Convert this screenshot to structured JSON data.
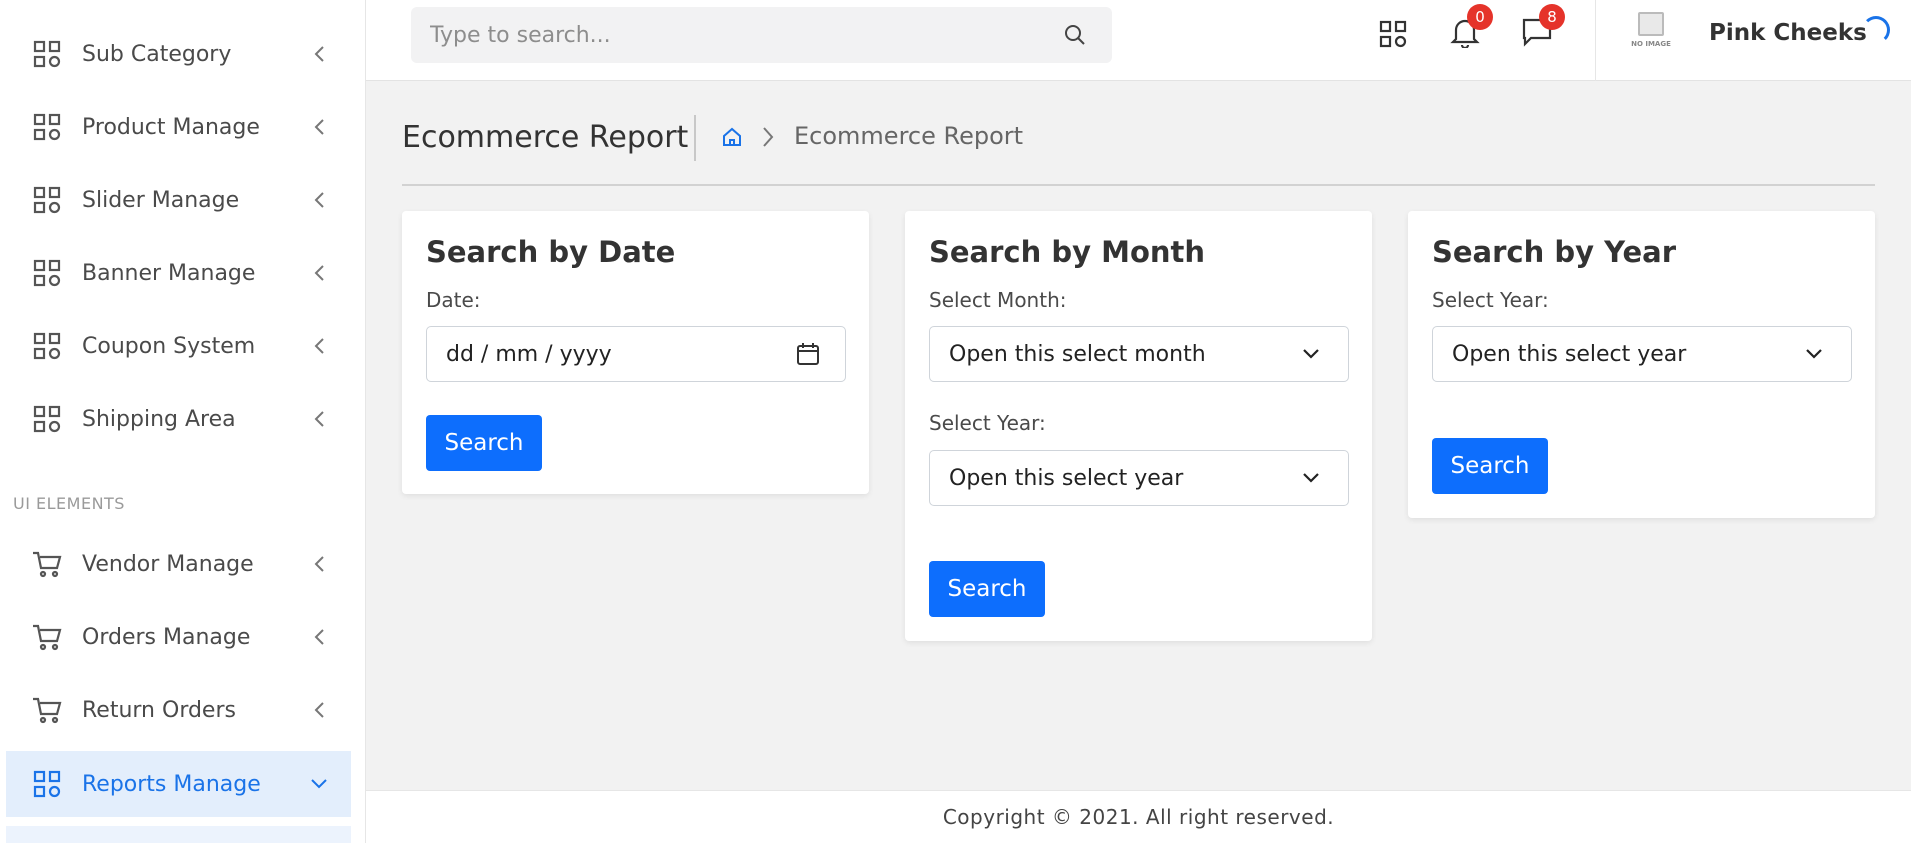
{
  "sidebar": {
    "items": [
      {
        "label": "Sub Category",
        "icon": "grid-icon"
      },
      {
        "label": "Product Manage",
        "icon": "grid-icon"
      },
      {
        "label": "Slider Manage",
        "icon": "grid-icon"
      },
      {
        "label": "Banner Manage",
        "icon": "grid-icon"
      },
      {
        "label": "Coupon System",
        "icon": "grid-icon"
      },
      {
        "label": "Shipping Area",
        "icon": "grid-icon"
      }
    ],
    "section_label": "UI ELEMENTS",
    "ui_items": [
      {
        "label": "Vendor Manage",
        "icon": "cart-icon"
      },
      {
        "label": "Orders Manage",
        "icon": "cart-icon"
      },
      {
        "label": "Return Orders",
        "icon": "cart-icon"
      },
      {
        "label": "Reports Manage",
        "icon": "grid-icon",
        "active": true
      }
    ]
  },
  "topbar": {
    "search_placeholder": "Type to search...",
    "notifications_count": "0",
    "messages_count": "8",
    "avatar_caption": "NO IMAGE",
    "user_name": "Pink Cheeks"
  },
  "page": {
    "title": "Ecommerce Report",
    "breadcrumb_current": "Ecommerce Report"
  },
  "cards": {
    "date": {
      "title": "Search by Date",
      "label": "Date:",
      "value": "dd / mm / yyyy",
      "button": "Search"
    },
    "month": {
      "title": "Search by Month",
      "month_label": "Select Month:",
      "month_value": "Open this select month",
      "year_label": "Select Year:",
      "year_value": "Open this select year",
      "button": "Search"
    },
    "year": {
      "title": "Search by Year",
      "label": "Select Year:",
      "value": "Open this select year",
      "button": "Search"
    }
  },
  "footer": {
    "text": "Copyright © 2021. All right reserved."
  },
  "colors": {
    "accent": "#1a73e8",
    "button": "#0d6efd",
    "badge": "#e5332a",
    "active_bg": "#e3eefc"
  }
}
